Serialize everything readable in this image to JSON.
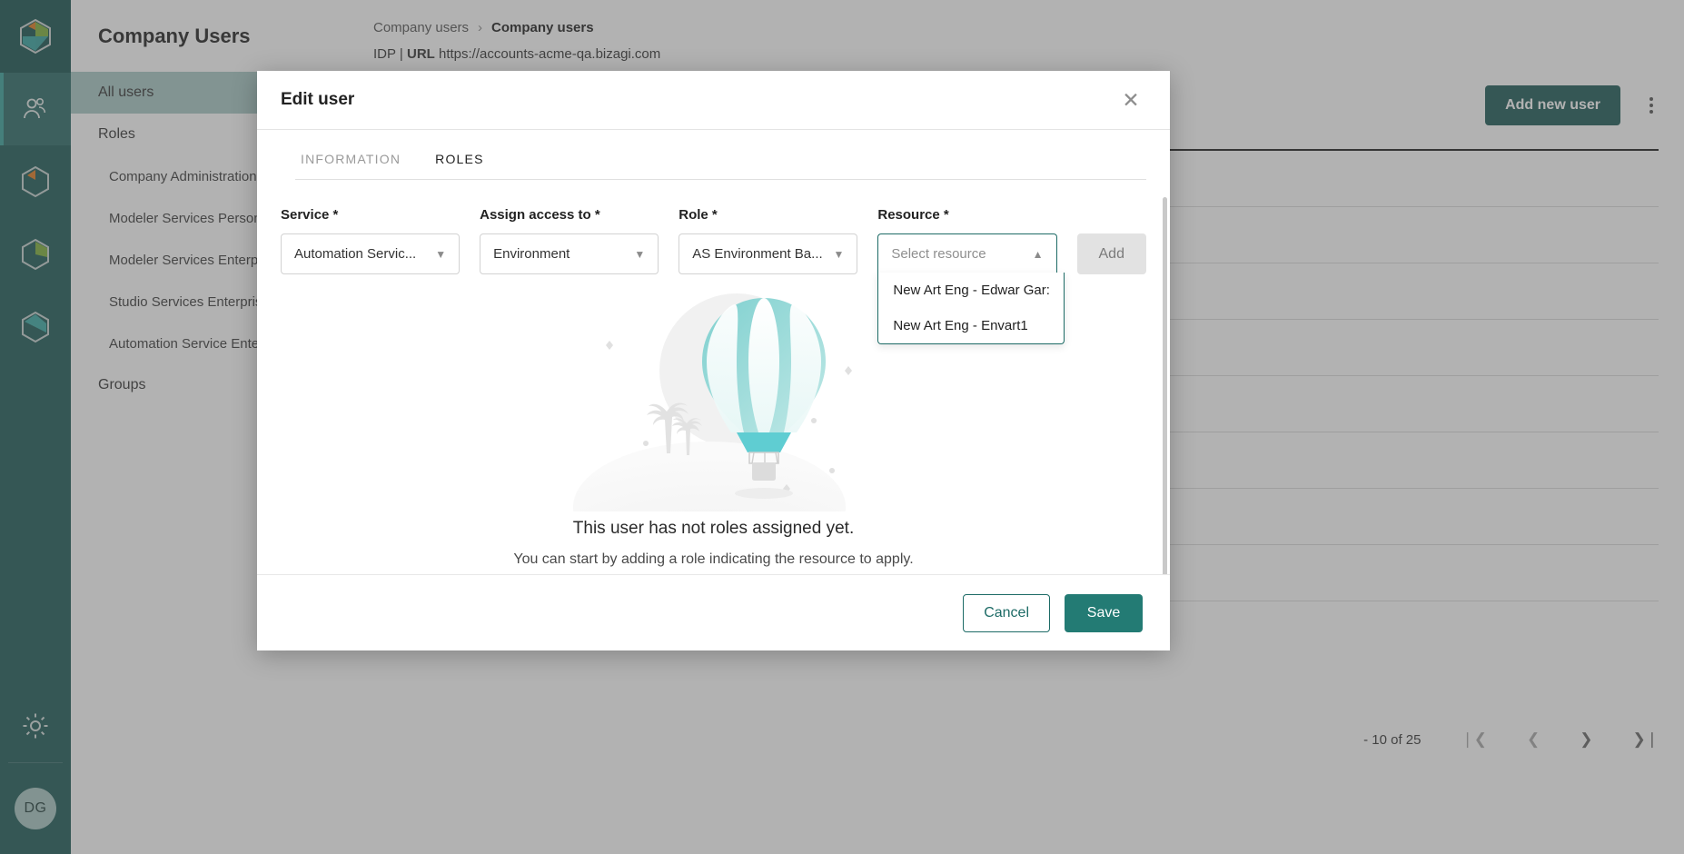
{
  "rail": {
    "logo_icon": "bizagi-hexagon-logo",
    "items": [
      {
        "icon": "users-icon",
        "name": "users",
        "active": true
      },
      {
        "icon": "hexagon-orange-icon",
        "name": "modeler",
        "active": false
      },
      {
        "icon": "hexagon-green-icon",
        "name": "studio",
        "active": false
      },
      {
        "icon": "hexagon-teal-icon",
        "name": "automation",
        "active": false
      }
    ],
    "gear_icon": "gear-icon",
    "avatar_initials": "DG"
  },
  "nav": {
    "title": "Company Users",
    "items": [
      {
        "label": "All users",
        "selected": true,
        "sub": false
      },
      {
        "label": "Roles",
        "selected": false,
        "sub": false
      },
      {
        "label": "Company Administration",
        "selected": false,
        "sub": true
      },
      {
        "label": "Modeler Services Personal",
        "selected": false,
        "sub": true
      },
      {
        "label": "Modeler Services Enterprise",
        "selected": false,
        "sub": true
      },
      {
        "label": "Studio Services Enterprise",
        "selected": false,
        "sub": true
      },
      {
        "label": "Automation Service Enterprise",
        "selected": false,
        "sub": true
      },
      {
        "label": "Groups",
        "selected": false,
        "sub": false
      }
    ]
  },
  "breadcrumb": {
    "parent": "Company users",
    "separator": "›",
    "current": "Company users"
  },
  "urlline": {
    "idp_label": "IDP",
    "pipe": "|",
    "url_label": "URL",
    "url_value": "https://accounts-acme-qa.bizagi.com"
  },
  "toolbar": {
    "add_user_label": "Add new user",
    "kebab_icon": "more-vertical-icon"
  },
  "pagination": {
    "range_text": "- 10 of 25",
    "first_icon": "❘❮",
    "prev_icon": "❮",
    "next_icon": "❯",
    "last_icon": "❯❘"
  },
  "modal": {
    "title": "Edit user",
    "close_icon": "close-icon",
    "tabs": [
      {
        "label": "INFORMATION",
        "active": false
      },
      {
        "label": "ROLES",
        "active": true
      }
    ],
    "fields": {
      "service": {
        "label": "Service *",
        "value": "Automation Servic...",
        "chevron": "⌄"
      },
      "assign_access": {
        "label": "Assign access to *",
        "value": "Environment",
        "chevron": "⌄"
      },
      "role": {
        "label": "Role *",
        "value": "AS Environment Ba...",
        "chevron": "⌄"
      },
      "resource": {
        "label": "Resource *",
        "placeholder": "Select resource",
        "chevron": "⌃",
        "open": true,
        "options": [
          "New Art Eng - Edwar Gar:",
          "New Art Eng - Envart1"
        ]
      }
    },
    "add_button": "Add",
    "empty_state": {
      "illustration": "hot-air-balloon-illustration",
      "heading": "This user has not roles assigned yet.",
      "sub": "You can start by adding a role indicating the resource to apply."
    },
    "footer": {
      "cancel": "Cancel",
      "save": "Save"
    }
  },
  "colors": {
    "brand_dark": "#1d5a56",
    "brand": "#237b74",
    "accent_border": "#1d6b66",
    "nav_selected": "#a8c8c5",
    "balloon_teal": "#6fc9c9"
  }
}
